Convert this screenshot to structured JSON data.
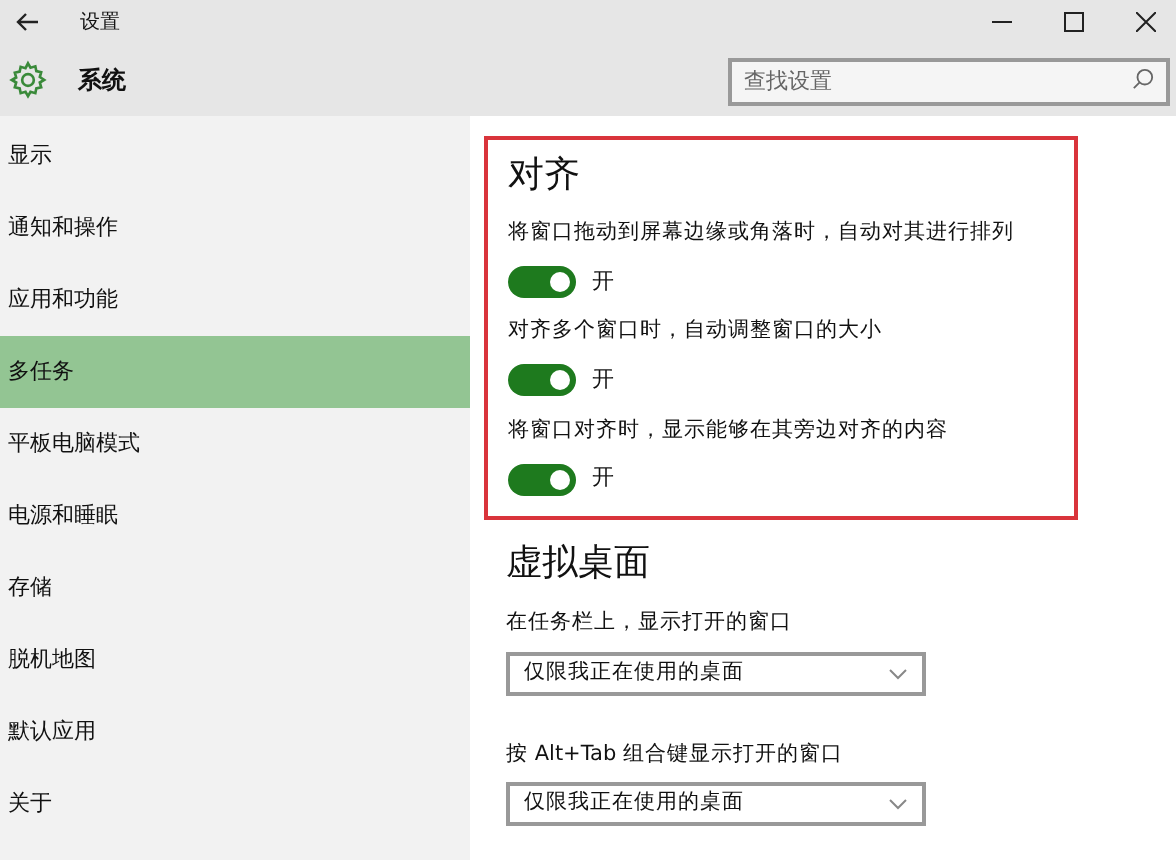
{
  "window": {
    "title": "设置"
  },
  "header": {
    "title": "系统",
    "search": {
      "placeholder": "查找设置"
    }
  },
  "sidebar": {
    "items": [
      {
        "label": "显示",
        "selected": false
      },
      {
        "label": "通知和操作",
        "selected": false
      },
      {
        "label": "应用和功能",
        "selected": false
      },
      {
        "label": "多任务",
        "selected": true
      },
      {
        "label": "平板电脑模式",
        "selected": false
      },
      {
        "label": "电源和睡眠",
        "selected": false
      },
      {
        "label": "存储",
        "selected": false
      },
      {
        "label": "脱机地图",
        "selected": false
      },
      {
        "label": "默认应用",
        "selected": false
      },
      {
        "label": "关于",
        "selected": false
      }
    ]
  },
  "snap": {
    "title": "对齐",
    "settings": [
      {
        "label": "将窗口拖动到屏幕边缘或角落时，自动对其进行排列",
        "on": true,
        "state_label": "开"
      },
      {
        "label": "对齐多个窗口时，自动调整窗口的大小",
        "on": true,
        "state_label": "开"
      },
      {
        "label": "将窗口对齐时，显示能够在其旁边对齐的内容",
        "on": true,
        "state_label": "开"
      }
    ]
  },
  "virtual_desktops": {
    "title": "虚拟桌面",
    "settings": [
      {
        "label": "在任务栏上，显示打开的窗口",
        "value": "仅限我正在使用的桌面"
      },
      {
        "label": "按 Alt+Tab 组合键显示打开的窗口",
        "value": "仅限我正在使用的桌面"
      }
    ]
  }
}
